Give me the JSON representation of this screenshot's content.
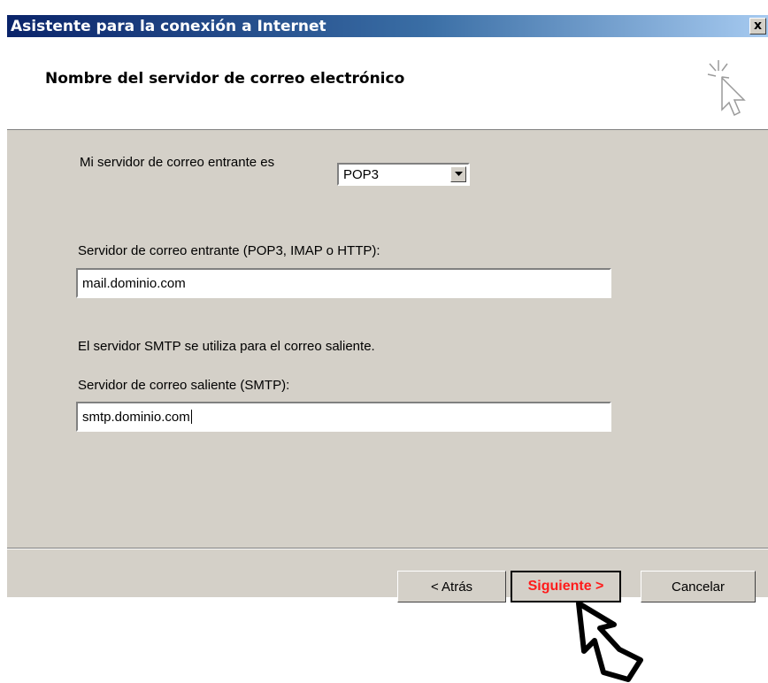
{
  "window": {
    "title": "Asistente para la conexión a Internet",
    "close_label": "x"
  },
  "header": {
    "title": "Nombre del servidor de correo electrónico"
  },
  "form": {
    "server_type_label": "Mi servidor de correo entrante es",
    "server_type_value": "POP3",
    "incoming_label": "Servidor de correo entrante (POP3, IMAP o HTTP):",
    "incoming_value": "mail.dominio.com",
    "smtp_note": "El servidor SMTP se utiliza para el correo saliente.",
    "outgoing_label": "Servidor de correo saliente (SMTP):",
    "outgoing_value": "smtp.dominio.com"
  },
  "buttons": {
    "back": "< Atrás",
    "next": "Siguiente >",
    "cancel": "Cancelar"
  },
  "colors": {
    "title_bar": "#0a246a",
    "dialog_bg": "#d4d0c8",
    "next_label": "#ff1a1a"
  },
  "icons": {
    "header": "wizard-cursor-sparkle-icon",
    "close": "close-icon",
    "dropdown": "chevron-down-icon",
    "pointer": "hand-pointer-icon"
  }
}
